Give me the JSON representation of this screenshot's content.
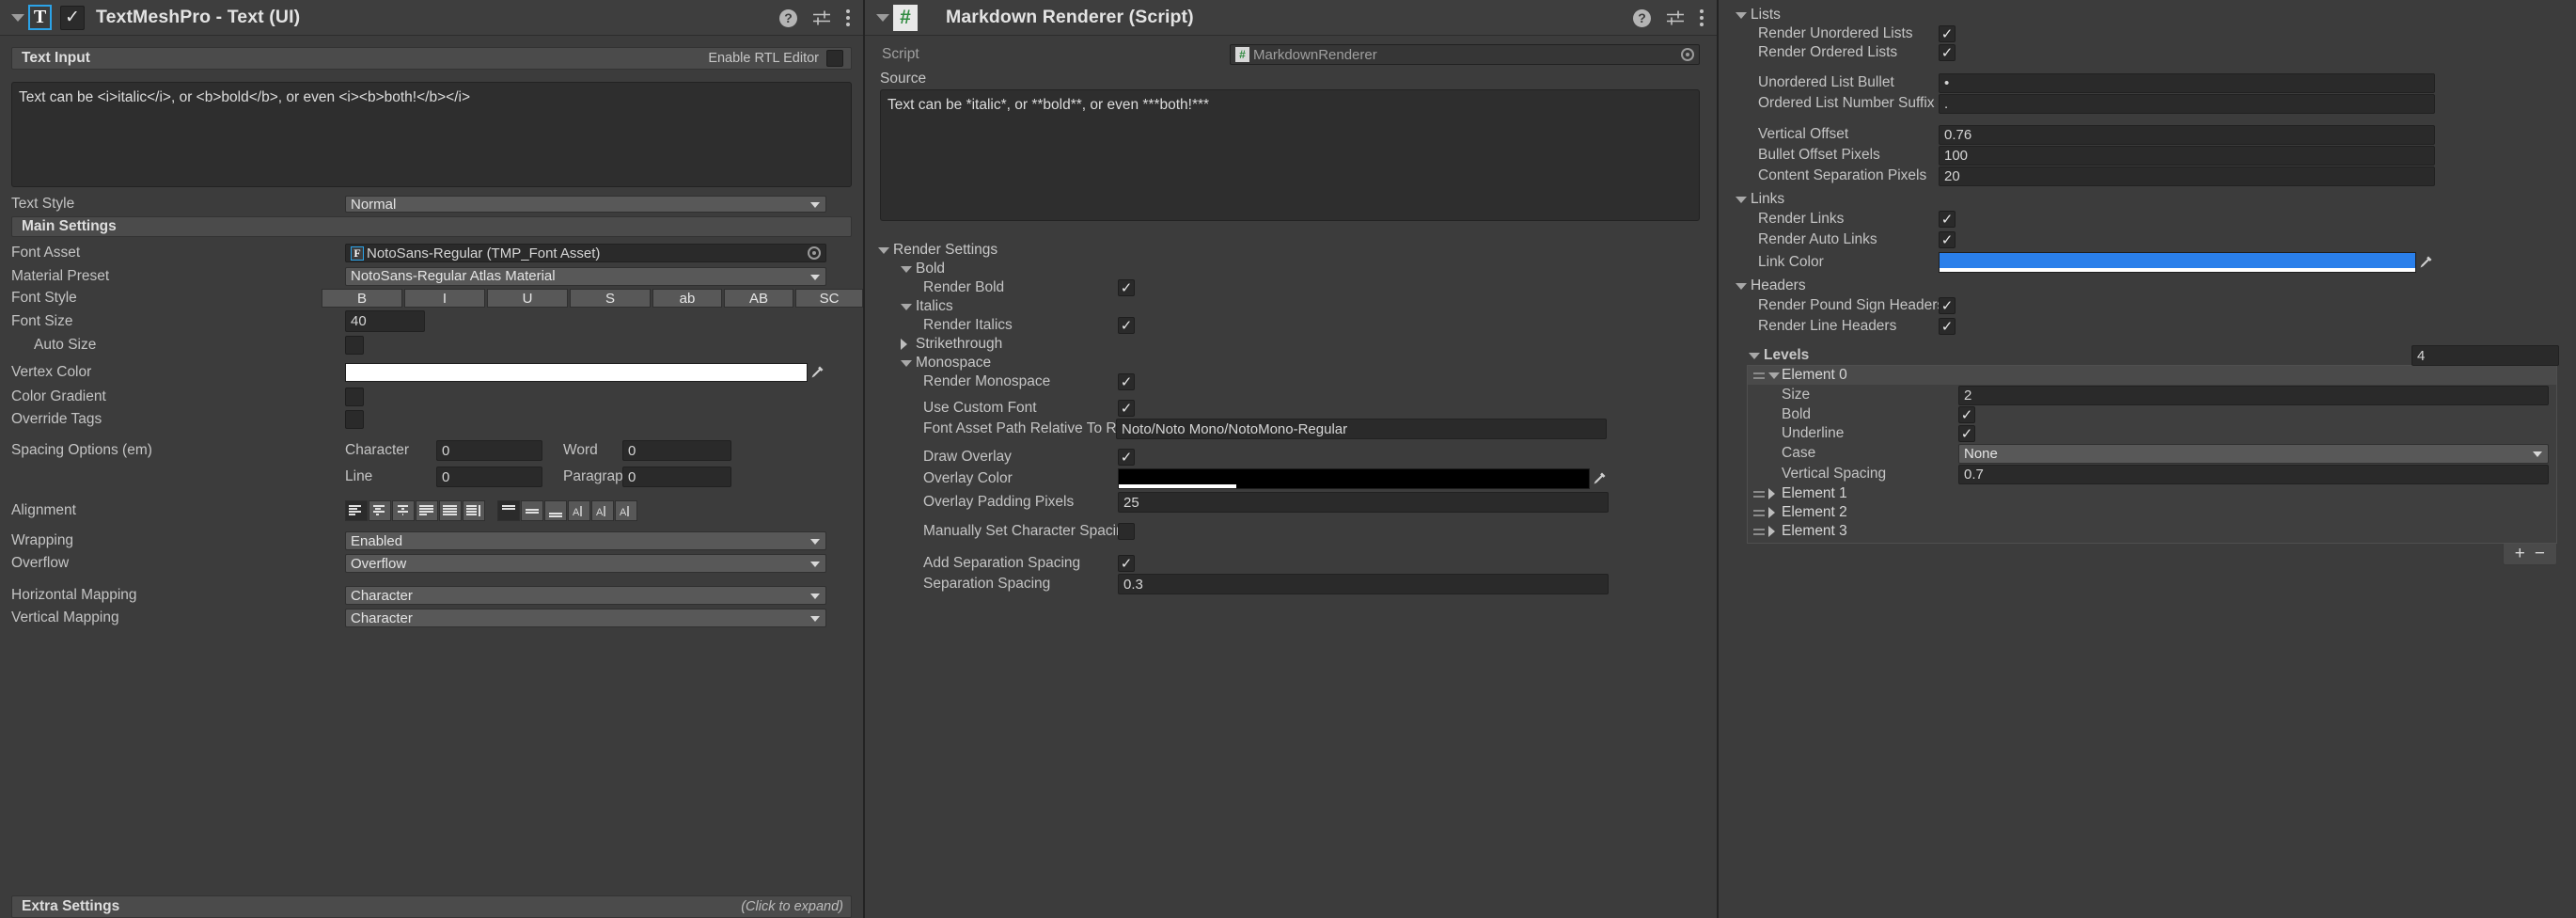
{
  "tmp_panel": {
    "header": {
      "title": "TextMeshPro - Text (UI)",
      "icon_letter": "T",
      "enabled_check": "✓",
      "help_icon": "?",
      "help_label": "help-icon",
      "preset_label": "preset-icon",
      "menu_label": "kebab-menu-icon"
    },
    "text_input_section": {
      "title": "Text Input",
      "rtl_label": "Enable RTL Editor",
      "rtl_checked": false,
      "text_value": "Text can be <i>italic</i>, or <b>bold</b>, or even <i><b>both!</b></i>"
    },
    "text_style": {
      "label": "Text Style",
      "value": "Normal"
    },
    "main_settings": {
      "title": "Main Settings"
    },
    "font_asset": {
      "label": "Font Asset",
      "value": "NotoSans-Regular (TMP_Font Asset)",
      "badge": "F"
    },
    "material_preset": {
      "label": "Material Preset",
      "value": "NotoSans-Regular Atlas Material"
    },
    "font_style": {
      "label": "Font Style",
      "buttons": [
        "B",
        "I",
        "U",
        "S",
        "ab",
        "AB",
        "SC"
      ]
    },
    "font_size": {
      "label": "Font Size",
      "value": "40"
    },
    "auto_size": {
      "label": "Auto Size",
      "checked": false
    },
    "vertex_color": {
      "label": "Vertex Color",
      "color": "#ffffff"
    },
    "color_gradient": {
      "label": "Color Gradient",
      "checked": false
    },
    "override_tags": {
      "label": "Override Tags",
      "checked": false
    },
    "spacing": {
      "label": "Spacing Options (em)",
      "character_label": "Character",
      "character_value": "0",
      "word_label": "Word",
      "word_value": "0",
      "line_label": "Line",
      "line_value": "0",
      "paragraph_label": "Paragraph",
      "paragraph_value": "0"
    },
    "alignment": {
      "label": "Alignment",
      "h_selected": 0,
      "v_selected": 0
    },
    "wrapping": {
      "label": "Wrapping",
      "value": "Enabled"
    },
    "overflow": {
      "label": "Overflow",
      "value": "Overflow"
    },
    "horizontal_mapping": {
      "label": "Horizontal Mapping",
      "value": "Character"
    },
    "vertical_mapping": {
      "label": "Vertical Mapping",
      "value": "Character"
    },
    "extra_settings": {
      "title": "Extra Settings",
      "hint": "(Click to expand)"
    }
  },
  "md_panel": {
    "header": {
      "title": "Markdown Renderer (Script)",
      "icon_letter": "#"
    },
    "script": {
      "label": "Script",
      "value": "MarkdownRenderer"
    },
    "source": {
      "label": "Source",
      "value": "Text can be *italic*, or **bold**, or even ***both!***"
    },
    "render_settings": {
      "label": "Render Settings"
    },
    "bold_group": {
      "label": "Bold"
    },
    "render_bold": {
      "label": "Render Bold",
      "checked": true
    },
    "italics_group": {
      "label": "Italics"
    },
    "render_italics": {
      "label": "Render Italics",
      "checked": true
    },
    "strikethrough_group": {
      "label": "Strikethrough"
    },
    "monospace_group": {
      "label": "Monospace"
    },
    "render_monospace": {
      "label": "Render Monospace",
      "checked": true
    },
    "use_custom_font": {
      "label": "Use Custom Font",
      "checked": true
    },
    "font_asset_path": {
      "label": "Font Asset Path Relative To Re",
      "value": "Noto/Noto Mono/NotoMono-Regular"
    },
    "draw_overlay": {
      "label": "Draw Overlay",
      "checked": true
    },
    "overlay_color": {
      "label": "Overlay Color",
      "color": "#000000",
      "alpha_fraction": 0.25
    },
    "overlay_padding": {
      "label": "Overlay Padding Pixels",
      "value": "25"
    },
    "manual_char_spacing": {
      "label": "Manually Set Character Spacin",
      "checked": false
    },
    "add_separation_spacing": {
      "label": "Add Separation Spacing",
      "checked": true
    },
    "separation_spacing": {
      "label": "Separation Spacing",
      "value": "0.3"
    }
  },
  "props_panel": {
    "lists_group": {
      "label": "Lists"
    },
    "render_unordered": {
      "label": "Render Unordered Lists",
      "checked": true
    },
    "render_ordered": {
      "label": "Render Ordered Lists",
      "checked": true
    },
    "unordered_bullet": {
      "label": "Unordered List Bullet",
      "value": "•"
    },
    "ordered_suffix": {
      "label": "Ordered List Number Suffix",
      "value": "."
    },
    "vertical_offset": {
      "label": "Vertical Offset",
      "value": "0.76"
    },
    "bullet_offset": {
      "label": "Bullet Offset Pixels",
      "value": "100"
    },
    "content_separation": {
      "label": "Content Separation Pixels",
      "value": "20"
    },
    "links_group": {
      "label": "Links"
    },
    "render_links": {
      "label": "Render Links",
      "checked": true
    },
    "render_auto_links": {
      "label": "Render Auto Links",
      "checked": true
    },
    "link_color": {
      "label": "Link Color",
      "color": "#2a7fea"
    },
    "headers_group": {
      "label": "Headers"
    },
    "render_pound_headers": {
      "label": "Render Pound Sign Headers",
      "checked": true
    },
    "render_line_headers": {
      "label": "Render Line Headers",
      "checked": true
    },
    "levels": {
      "label": "Levels",
      "count": "4",
      "element0": {
        "label": "Element 0",
        "size": {
          "label": "Size",
          "value": "2"
        },
        "bold": {
          "label": "Bold",
          "checked": true
        },
        "underline": {
          "label": "Underline",
          "checked": true
        },
        "case": {
          "label": "Case",
          "value": "None"
        },
        "vertical_spacing": {
          "label": "Vertical Spacing",
          "value": "0.7"
        }
      },
      "collapsed": [
        "Element 1",
        "Element 2",
        "Element 3"
      ],
      "add_label": "+",
      "remove_label": "−"
    }
  }
}
